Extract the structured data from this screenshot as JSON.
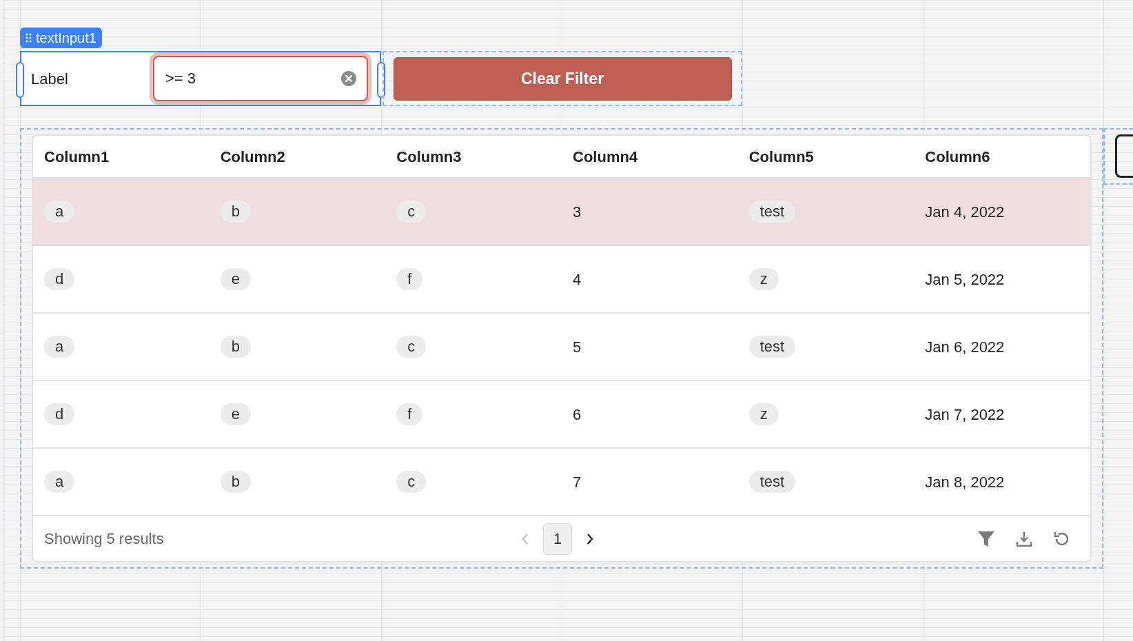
{
  "component_label": {
    "text": "textInput1"
  },
  "text_input": {
    "label": "Label",
    "value": ">= 3",
    "focused": true
  },
  "clear_button": {
    "label": "Clear Filter"
  },
  "table": {
    "columns": [
      {
        "label": "Column1",
        "kind": "tag"
      },
      {
        "label": "Column2",
        "kind": "tag"
      },
      {
        "label": "Column3",
        "kind": "tag"
      },
      {
        "label": "Column4",
        "kind": "text"
      },
      {
        "label": "Column5",
        "kind": "tag"
      },
      {
        "label": "Column6",
        "kind": "text"
      }
    ],
    "rows": [
      {
        "selected": true,
        "cells": [
          "a",
          "b",
          "c",
          "3",
          "test",
          "Jan 4, 2022"
        ]
      },
      {
        "selected": false,
        "cells": [
          "d",
          "e",
          "f",
          "4",
          "z",
          "Jan 5, 2022"
        ]
      },
      {
        "selected": false,
        "cells": [
          "a",
          "b",
          "c",
          "5",
          "test",
          "Jan 6, 2022"
        ]
      },
      {
        "selected": false,
        "cells": [
          "d",
          "e",
          "f",
          "6",
          "z",
          "Jan 7, 2022"
        ]
      },
      {
        "selected": false,
        "cells": [
          "a",
          "b",
          "c",
          "7",
          "test",
          "Jan 8, 2022"
        ]
      }
    ],
    "footer": {
      "summary": "Showing 5 results",
      "page": "1"
    }
  }
}
